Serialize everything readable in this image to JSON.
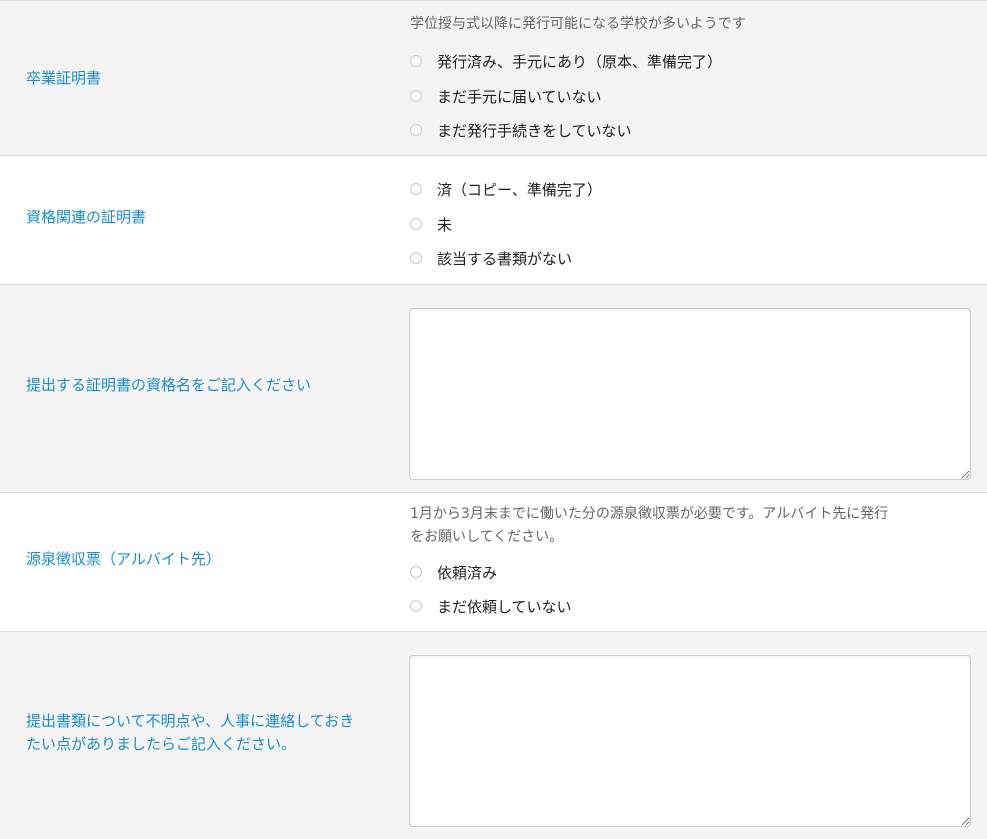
{
  "rows": {
    "graduation": {
      "label": "卒業証明書",
      "note": "学位授与式以降に発行可能になる学校が多いようです",
      "options": [
        "発行済み、手元にあり（原本、準備完了）",
        "まだ手元に届いていない",
        "まだ発行手続きをしていない"
      ]
    },
    "qualification": {
      "label": "資格関連の証明書",
      "options": [
        "済（コピー、準備完了）",
        "未",
        "該当する書類がない"
      ]
    },
    "qualification_name": {
      "label": "提出する証明書の資格名をご記入ください",
      "value": ""
    },
    "withholding": {
      "label": "源泉徴収票（アルバイト先）",
      "note_line1": "1月から3月末までに働いた分の源泉徴収票が必要です。アルバイト先に発行",
      "note_line2": "をお願いしてください。",
      "options": [
        "依頼済み",
        "まだ依頼していない"
      ]
    },
    "questions": {
      "label_line1": "提出書類について不明点や、人事に連絡しておき",
      "label_line2": "たい点がありましたらご記入ください。",
      "value": ""
    }
  },
  "colors": {
    "label": "#1a8ec8",
    "row_gray": "#f4f4f4",
    "divider": "#dcdcdc"
  }
}
